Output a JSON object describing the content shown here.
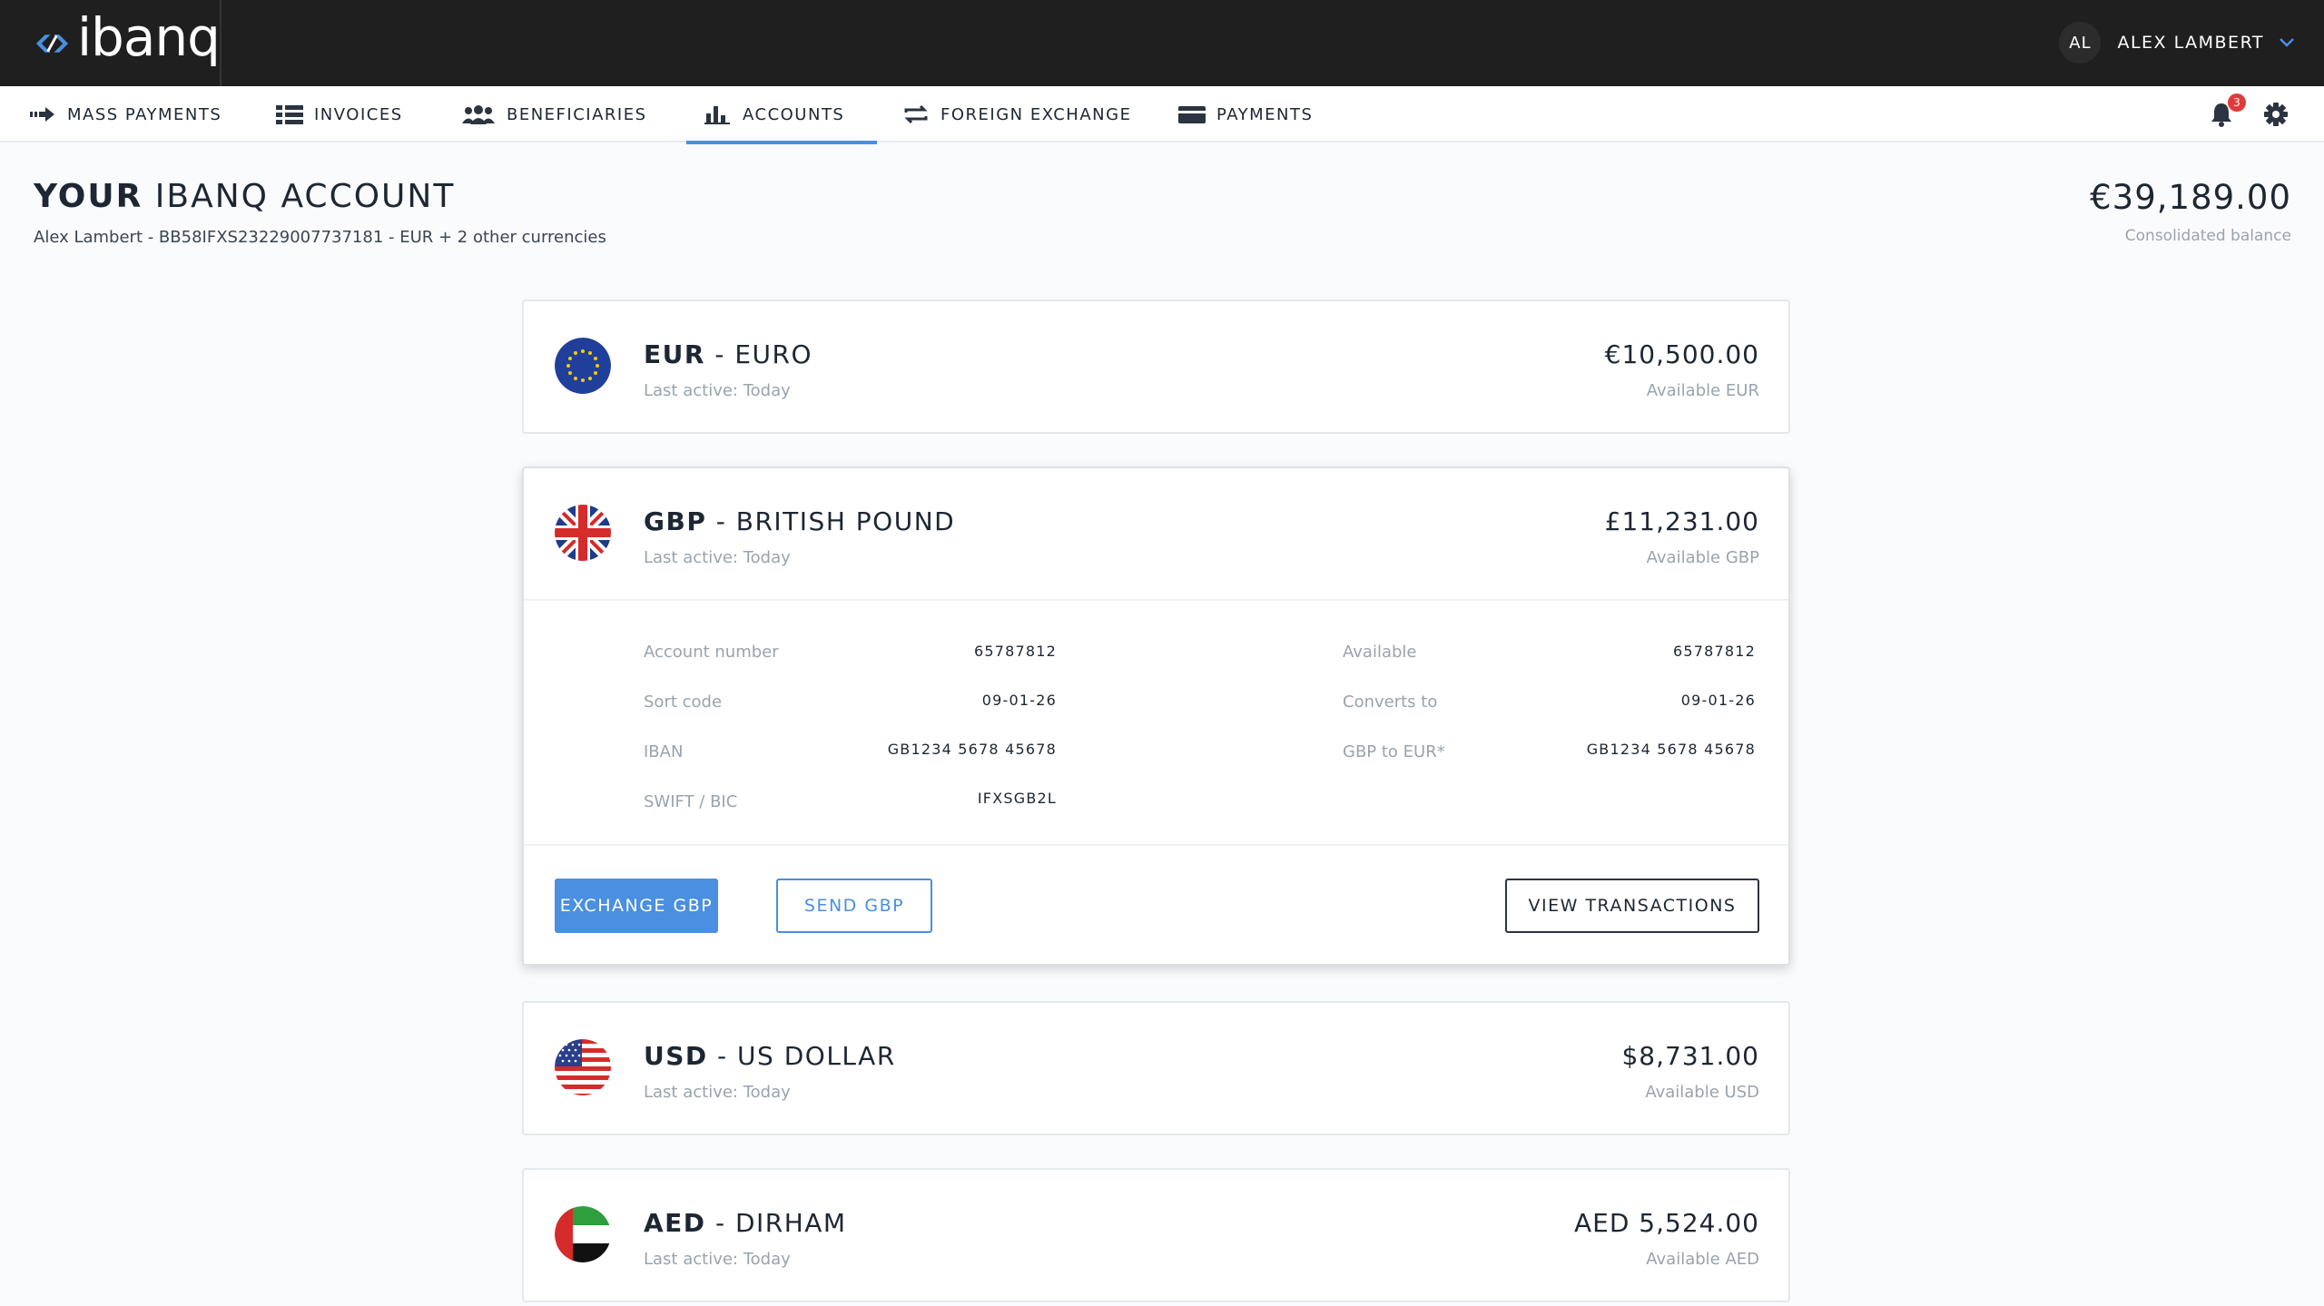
{
  "app": {
    "logo_text": "ibanq",
    "user_initials": "AL",
    "user_name": "ALEX LAMBERT"
  },
  "nav": {
    "items": [
      {
        "label": "MASS PAYMENTS",
        "icon": "mass-payments-icon"
      },
      {
        "label": "INVOICES",
        "icon": "invoices-icon"
      },
      {
        "label": "BENEFICIARIES",
        "icon": "beneficiaries-icon"
      },
      {
        "label": "ACCOUNTS",
        "icon": "accounts-icon",
        "active": true
      },
      {
        "label": "FOREIGN EXCHANGE",
        "icon": "foreign-exchange-icon"
      },
      {
        "label": "PAYMENTS",
        "icon": "payments-icon"
      }
    ],
    "notification_count": "3"
  },
  "header": {
    "title_strong": "YOUR",
    "title_rest": " IBANQ ACCOUNT",
    "subtitle": "Alex Lambert - BB58IFXS23229007737181 - EUR + 2 other currencies",
    "balance": "€39,189.00",
    "balance_label": "Consolidated balance"
  },
  "accounts": [
    {
      "code": "EUR",
      "name": " - EURO",
      "last_active": "Last active: Today",
      "amount": "€10,500.00",
      "available": "Available EUR",
      "flag": "eu-flag"
    },
    {
      "code": "GBP",
      "name": " - BRITISH POUND",
      "last_active": "Last active: Today",
      "amount": "£11,231.00",
      "available": "Available GBP",
      "flag": "uk-flag",
      "details_left": [
        {
          "label": "Account number",
          "value": "65787812"
        },
        {
          "label": "Sort code",
          "value": "09-01-26"
        },
        {
          "label": "IBAN",
          "value": "GB1234 5678 45678"
        },
        {
          "label": "SWIFT / BIC",
          "value": "IFXSGB2L"
        }
      ],
      "details_right": [
        {
          "label": "Available",
          "value": "65787812"
        },
        {
          "label": "Converts to",
          "value": "09-01-26"
        },
        {
          "label": "GBP to EUR*",
          "value": "GB1234 5678 45678"
        }
      ],
      "actions": {
        "exchange": "EXCHANGE GBP",
        "send": "SEND GBP",
        "view": "VIEW TRANSACTIONS"
      }
    },
    {
      "code": "USD",
      "name": " - US DOLLAR",
      "last_active": "Last active: Today",
      "amount": "$8,731.00",
      "available": "Available USD",
      "flag": "us-flag"
    },
    {
      "code": "AED",
      "name": " - DIRHAM",
      "last_active": "Last active: Today",
      "amount": "AED 5,524.00",
      "available": "Available AED",
      "flag": "uae-flag"
    }
  ],
  "colors": {
    "accent": "#4a8fe0",
    "topbar": "#1f1f1f",
    "badge": "#e23a3a"
  }
}
